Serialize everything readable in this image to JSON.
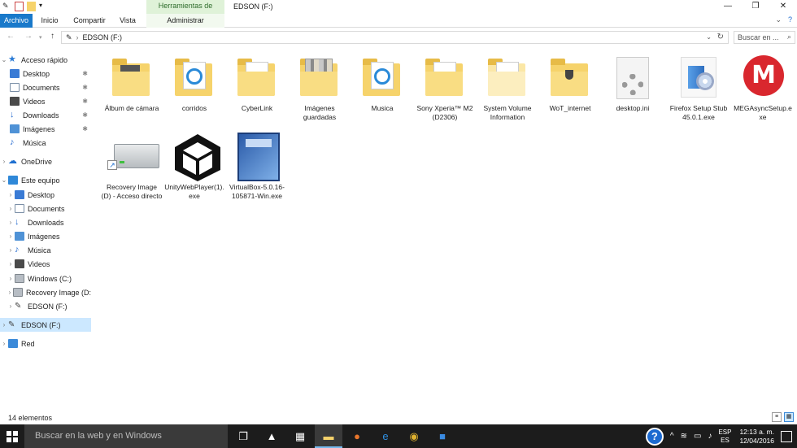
{
  "window": {
    "title": "EDSON (F:)",
    "tool_header": "Herramientas de unidad",
    "controls": {
      "minimize": "—",
      "maximize": "❐",
      "close": "✕"
    }
  },
  "ribbon": {
    "tabs": [
      "Archivo",
      "Inicio",
      "Compartir",
      "Vista",
      "Administrar"
    ],
    "right": {
      "expand": "⌄",
      "help": "?"
    }
  },
  "address": {
    "separator": "›",
    "path": "EDSON (F:)",
    "search_placeholder": "Buscar en ..."
  },
  "nav": {
    "quick_access": "Acceso rápido",
    "quick_items": [
      "Desktop",
      "Documents",
      "Videos",
      "Downloads",
      "Imágenes",
      "Música"
    ],
    "onedrive": "OneDrive",
    "this_pc": "Este equipo",
    "pc_items": [
      "Desktop",
      "Documents",
      "Downloads",
      "Imágenes",
      "Música",
      "Videos",
      "Windows (C:)",
      "Recovery Image (D:",
      "EDSON (F:)"
    ],
    "selected_drive": "EDSON (F:)",
    "network": "Red"
  },
  "files": [
    "Álbum de cámara",
    "corridos",
    "CyberLink",
    "Imágenes guardadas",
    "Musica",
    "Sony Xperia™ M2 (D2306)",
    "System Volume Information",
    "WoT_internet",
    "desktop.ini",
    "Firefox Setup Stub 45.0.1.exe",
    "MEGAsyncSetup.exe",
    "Recovery Image (D) - Acceso directo",
    "UnityWebPlayer(1).exe",
    "VirtualBox-5.0.16-105871-Win.exe"
  ],
  "status": {
    "count": "14 elementos"
  },
  "taskbar": {
    "search_placeholder": "Buscar en la web y en Windows",
    "lang_top": "ESP",
    "lang_bottom": "ES",
    "time": "12:13 a. m.",
    "date": "12/04/2016",
    "help": "?"
  }
}
